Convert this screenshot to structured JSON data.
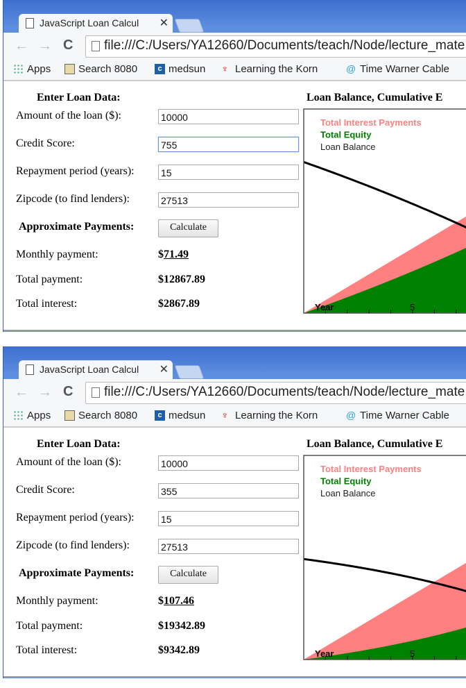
{
  "windows": [
    {
      "tab_title": "JavaScript Loan Calcul",
      "url": "file:///C:/Users/YA12660/Documents/teach/Node/lecture_mate",
      "bookmarks": [
        "Apps",
        "Search 8080",
        "medsun",
        "Learning the Korn",
        "Time Warner Cable"
      ],
      "form": {
        "heading": "Enter Loan Data:",
        "amount_label": "Amount of the loan ($):",
        "amount": "10000",
        "credit_label": "Credit Score:",
        "credit": "755",
        "period_label": "Repayment period (years):",
        "period": "15",
        "zip_label": "Zipcode (to find lenders):",
        "zip": "27513",
        "payments_heading": "Approximate Payments:",
        "calculate": "Calculate",
        "monthly_label": "Monthly payment:",
        "monthly_cur": "$",
        "monthly": "71.49",
        "total_label": "Total payment:",
        "total": "$12867.89",
        "interest_label": "Total interest:",
        "interest": "$2867.89"
      },
      "chart_data": {
        "type": "area",
        "title": "Loan Balance, Cumulative E",
        "legend": [
          "Total Interest Payments",
          "Total Equity",
          "Loan Balance"
        ],
        "xlabel": "Year",
        "x_tick_label": "5",
        "principal": 10000,
        "monthly_payment": 71.49,
        "years": 15,
        "total_payment": 12867.89
      }
    },
    {
      "tab_title": "JavaScript Loan Calcul",
      "url": "file:///C:/Users/YA12660/Documents/teach/Node/lecture_mate",
      "bookmarks": [
        "Apps",
        "Search 8080",
        "medsun",
        "Learning the Korn",
        "Time Warner Cable"
      ],
      "form": {
        "heading": "Enter Loan Data:",
        "amount_label": "Amount of the loan ($):",
        "amount": "10000",
        "credit_label": "Credit Score:",
        "credit": "355",
        "period_label": "Repayment period (years):",
        "period": "15",
        "zip_label": "Zipcode (to find lenders):",
        "zip": "27513",
        "payments_heading": "Approximate Payments:",
        "calculate": "Calculate",
        "monthly_label": "Monthly payment:",
        "monthly_cur": "$",
        "monthly": "107.46",
        "total_label": "Total payment:",
        "total": "$19342.89",
        "interest_label": "Total interest:",
        "interest": "$9342.89"
      },
      "chart_data": {
        "type": "area",
        "title": "Loan Balance, Cumulative E",
        "legend": [
          "Total Interest Payments",
          "Total Equity",
          "Loan Balance"
        ],
        "xlabel": "Year",
        "x_tick_label": "5",
        "principal": 10000,
        "monthly_payment": 107.46,
        "years": 15,
        "total_payment": 19342.89
      }
    }
  ],
  "colors": {
    "interest": "#ff8080",
    "equity": "#008000",
    "balance": "#000000",
    "chrome": "#5d8ee0"
  }
}
